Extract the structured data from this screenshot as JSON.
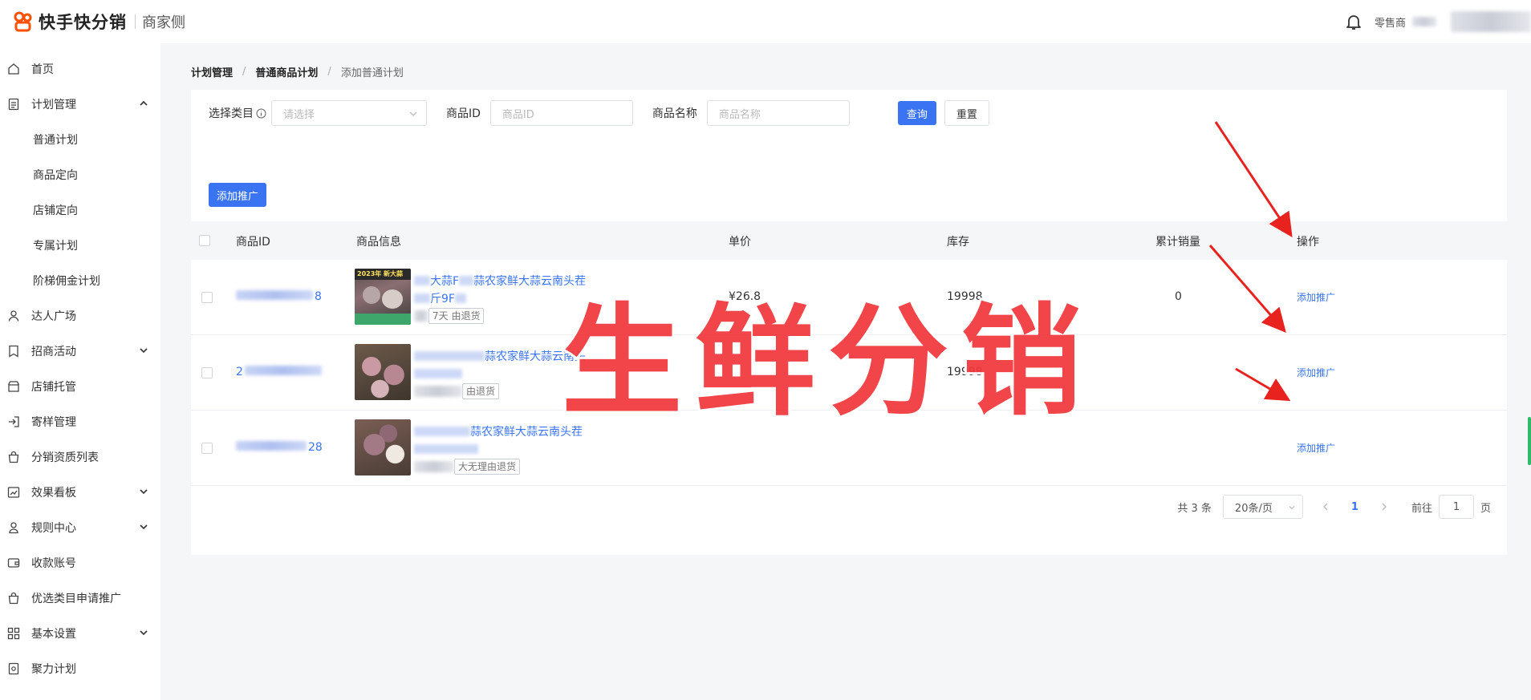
{
  "header": {
    "logo_text": "快手快分销",
    "logo_sub": "商家侧",
    "user_role": "零售商"
  },
  "sidebar": {
    "items": [
      {
        "label": "首页",
        "icon": "home-icon"
      },
      {
        "label": "计划管理",
        "icon": "document-icon",
        "expanded": true
      },
      {
        "label": "普通计划",
        "sub": true
      },
      {
        "label": "商品定向",
        "sub": true
      },
      {
        "label": "店铺定向",
        "sub": true
      },
      {
        "label": "专属计划",
        "sub": true
      },
      {
        "label": "阶梯佣金计划",
        "sub": true
      },
      {
        "label": "达人广场",
        "icon": "user-icon"
      },
      {
        "label": "招商活动",
        "icon": "bookmark-icon",
        "has_chevron": true
      },
      {
        "label": "店铺托管",
        "icon": "store-icon"
      },
      {
        "label": "寄样管理",
        "icon": "login-icon"
      },
      {
        "label": "分销资质列表",
        "icon": "bag-icon"
      },
      {
        "label": "效果看板",
        "icon": "chart-icon",
        "has_chevron": true
      },
      {
        "label": "规则中心",
        "icon": "person-rules-icon",
        "has_chevron": true
      },
      {
        "label": "收款账号",
        "icon": "wallet-icon"
      },
      {
        "label": "优选类目申请推广",
        "icon": "bag-icon"
      },
      {
        "label": "基本设置",
        "icon": "grid-icon",
        "has_chevron": true
      },
      {
        "label": "聚力计划",
        "icon": "file-icon"
      }
    ]
  },
  "breadcrumb": [
    "计划管理",
    "普通商品计划",
    "添加普通计划"
  ],
  "filters": {
    "category_label": "选择类目",
    "category_placeholder": "请选择",
    "product_id_label": "商品ID",
    "product_id_placeholder": "商品ID",
    "product_name_label": "商品名称",
    "product_name_placeholder": "商品名称",
    "query_button": "查询",
    "reset_button": "重置",
    "add_button": "添加推广"
  },
  "table": {
    "columns": [
      "商品ID",
      "商品信息",
      "单价",
      "库存",
      "累计销量",
      "操作"
    ],
    "rows": [
      {
        "id_suffix": "8",
        "title_tail": "大蒜F",
        "title_main": "蒜农家鲜大蒜云南头茬",
        "line2": "斤9F",
        "tag": "7天 由退货",
        "price": "¥26.8",
        "stock": "19998",
        "sales": "0",
        "action": "添加推广"
      },
      {
        "id_suffix": "2",
        "title_tail": "",
        "title_main": "蒜农家鲜大蒜云南头",
        "line2": "",
        "tag": "由退货",
        "price": "",
        "stock": "19998",
        "sales": "",
        "action": "添加推广"
      },
      {
        "id_suffix": "28",
        "title_tail": "",
        "title_main": "蒜农家鲜大蒜云南头茬",
        "line2": "",
        "tag": "大无理由退货",
        "price": "",
        "stock": "",
        "sales": "",
        "action": "添加推广"
      }
    ],
    "image_label": "2023年 新大蒜"
  },
  "pagination": {
    "total": "共 3 条",
    "page_size": "20条/页",
    "current_page": "1",
    "goto_label": "前往",
    "goto_value": "1",
    "page_unit": "页"
  },
  "overlay_text": "生鲜分销",
  "colors": {
    "primary": "#3a74f2",
    "overlay": "#f0373d",
    "brand": "#ff5000"
  }
}
